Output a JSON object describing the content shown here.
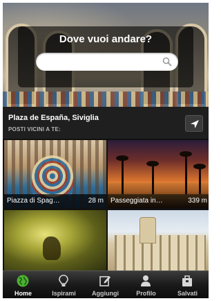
{
  "search": {
    "title": "Dove vuoi andare?",
    "placeholder": "",
    "value": "",
    "icon": "search-icon"
  },
  "location": {
    "name": "Plaza de España, Siviglia",
    "subtitle": "POSTI VICINI A TE:",
    "locate_icon": "location-arrow-icon"
  },
  "places": [
    {
      "name": "Piazza di Spag…",
      "distance": "28 m"
    },
    {
      "name": "Passeggiata in…",
      "distance": "339 m"
    },
    {
      "name": "",
      "distance": ""
    },
    {
      "name": "",
      "distance": ""
    }
  ],
  "tabs": [
    {
      "label": "Home",
      "icon": "globe-icon",
      "active": true
    },
    {
      "label": "Ispirami",
      "icon": "lightbulb-icon",
      "active": false
    },
    {
      "label": "Aggiungi",
      "icon": "edit-icon",
      "active": false
    },
    {
      "label": "Profilo",
      "icon": "user-icon",
      "active": false
    },
    {
      "label": "Salvati",
      "icon": "bag-icon",
      "active": false
    }
  ],
  "colors": {
    "active_tab": "#4caf32",
    "tab_inactive": "#c9c9c9",
    "bar_bg": "#1f1f1f"
  }
}
